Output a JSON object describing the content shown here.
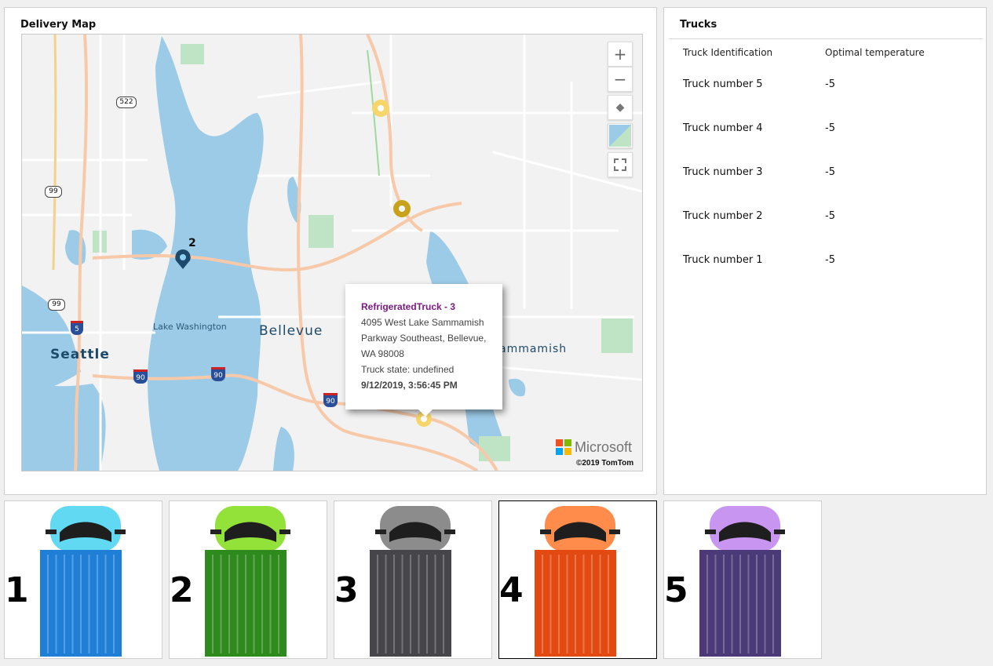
{
  "map_panel": {
    "title": "Delivery Map"
  },
  "map": {
    "labels": {
      "seattle": "Seattle",
      "bellevue": "Bellevue",
      "lake_washington": "Lake Washington",
      "sammamish": "ammamish"
    },
    "shields": {
      "s522": "522",
      "s99a": "99",
      "s99b": "99",
      "i5": "5",
      "i90a": "90",
      "i90b": "90",
      "i90c": "90"
    },
    "pin_label": "2",
    "popup": {
      "title": "RefrigeratedTruck - 3",
      "address_line1": "4095 West Lake Sammamish",
      "address_line2": "Parkway Southeast, Bellevue,",
      "address_line3": "WA 98008",
      "state": "Truck state: undefined",
      "timestamp": "9/12/2019, 3:56:45 PM"
    },
    "microsoft": "Microsoft",
    "copyright": "©2019 TomTom",
    "controls": {
      "zoom_in": "+",
      "zoom_out": "−"
    }
  },
  "trucks_panel": {
    "title": "Trucks",
    "columns": [
      "Truck Identification",
      "Optimal temperature"
    ],
    "rows": [
      {
        "id": "Truck number 5",
        "temp": "-5"
      },
      {
        "id": "Truck number 4",
        "temp": "-5"
      },
      {
        "id": "Truck number 3",
        "temp": "-5"
      },
      {
        "id": "Truck number 2",
        "temp": "-5"
      },
      {
        "id": "Truck number 1",
        "temp": "-5"
      }
    ]
  },
  "truck_tiles": [
    {
      "number": "1",
      "cab_color": "#62d9f2",
      "body_color": "#1f7fd6",
      "selected": false
    },
    {
      "number": "2",
      "cab_color": "#93e23a",
      "body_color": "#2f8a1e",
      "selected": false
    },
    {
      "number": "3",
      "cab_color": "#8c8c8c",
      "body_color": "#46464a",
      "selected": false
    },
    {
      "number": "4",
      "cab_color": "#ff8c4a",
      "body_color": "#e24a12",
      "selected": true
    },
    {
      "number": "5",
      "cab_color": "#c896f0",
      "body_color": "#4a3a78",
      "selected": false
    }
  ]
}
